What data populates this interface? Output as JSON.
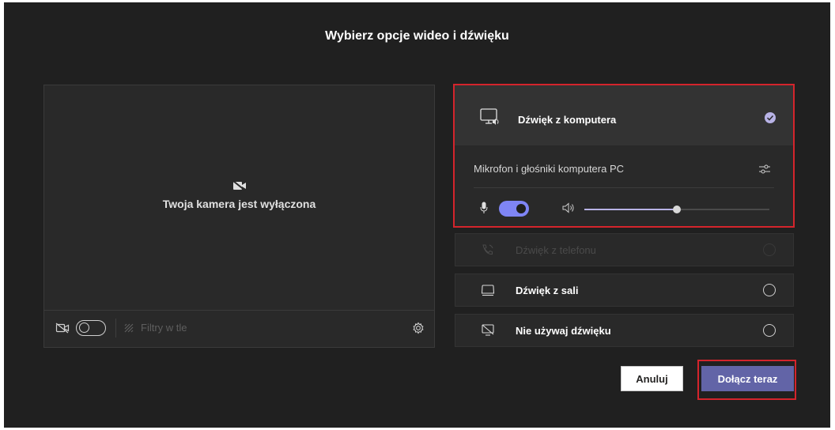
{
  "dialog": {
    "title": "Wybierz opcje wideo i dźwięku"
  },
  "preview": {
    "camera_off_message": "Twoja kamera jest wyłączona",
    "camera_toggle_on": false,
    "filters_label": "Filtry w tle"
  },
  "audio": {
    "computer": {
      "label": "Dźwięk z komputera",
      "selected": true,
      "device": "Mikrofon i głośniki komputera PC",
      "mic_on": true,
      "speaker_volume": 0.5
    },
    "options": [
      {
        "label": "Dźwięk z telefonu",
        "icon": "phone-icon",
        "disabled": true
      },
      {
        "label": "Dźwięk z sali",
        "icon": "room-icon",
        "disabled": false
      },
      {
        "label": "Nie używaj dźwięku",
        "icon": "no-audio-icon",
        "disabled": false
      }
    ]
  },
  "buttons": {
    "cancel": "Anuluj",
    "join": "Dołącz teraz"
  },
  "colors": {
    "accent": "#6264a7",
    "toggle_on": "#7f85f5",
    "highlight_border": "#d4242c",
    "background": "#202020"
  }
}
